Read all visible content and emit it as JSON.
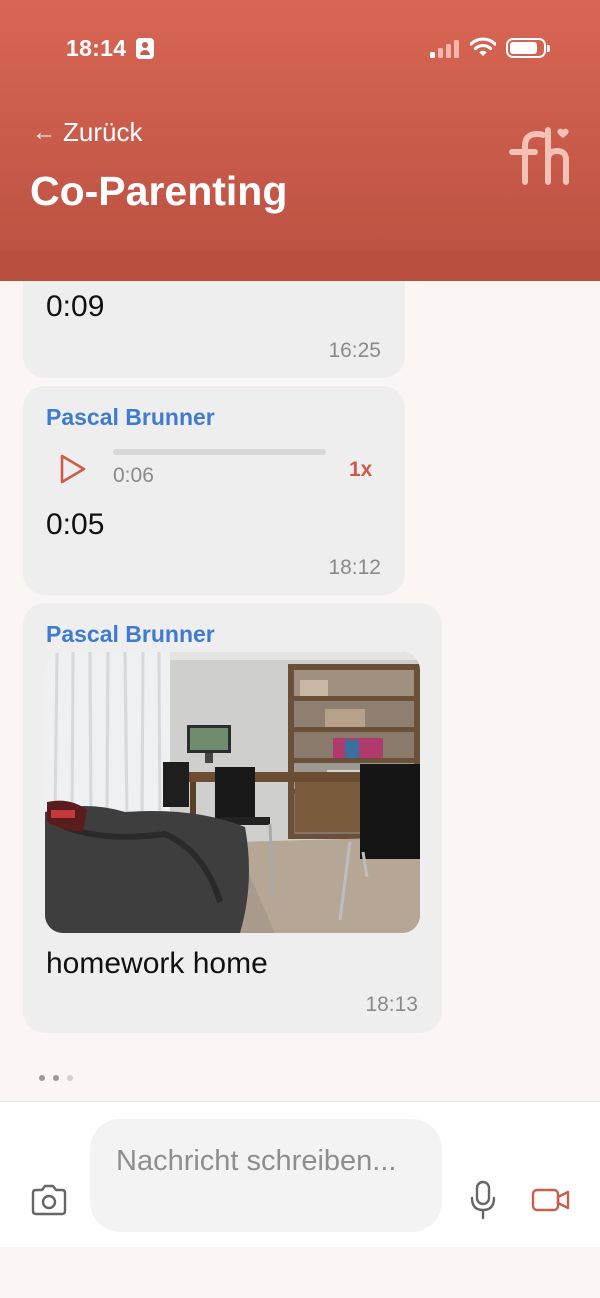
{
  "status_bar": {
    "time": "18:14"
  },
  "header": {
    "back_label": "Zurück",
    "back_arrow": "←",
    "title": "Co-Parenting",
    "logo_text": "fh"
  },
  "messages": [
    {
      "type": "audio-partial",
      "caption": "0:09",
      "time": "16:25"
    },
    {
      "type": "audio",
      "sender": "Pascal Brunner",
      "elapsed": "0:06",
      "progress": 0.0,
      "speed": "1x",
      "caption": "0:05",
      "time": "18:12"
    },
    {
      "type": "image",
      "sender": "Pascal Brunner",
      "caption": "homework home",
      "time": "18:13"
    }
  ],
  "composer": {
    "placeholder": "Nachricht schreiben..."
  },
  "icons": {
    "id": "person-badge-icon",
    "signal": "signal-icon",
    "wifi": "wifi-icon",
    "battery": "battery-icon",
    "back": "arrow-left-icon",
    "play": "play-icon",
    "camera": "camera-icon",
    "mic": "microphone-icon",
    "video": "video-camera-icon"
  },
  "colors": {
    "header": "#c85a4a",
    "accent": "#cf5b49",
    "sender": "#3f7bd1",
    "bubble": "#efeeee",
    "background": "#fbf6f4"
  }
}
